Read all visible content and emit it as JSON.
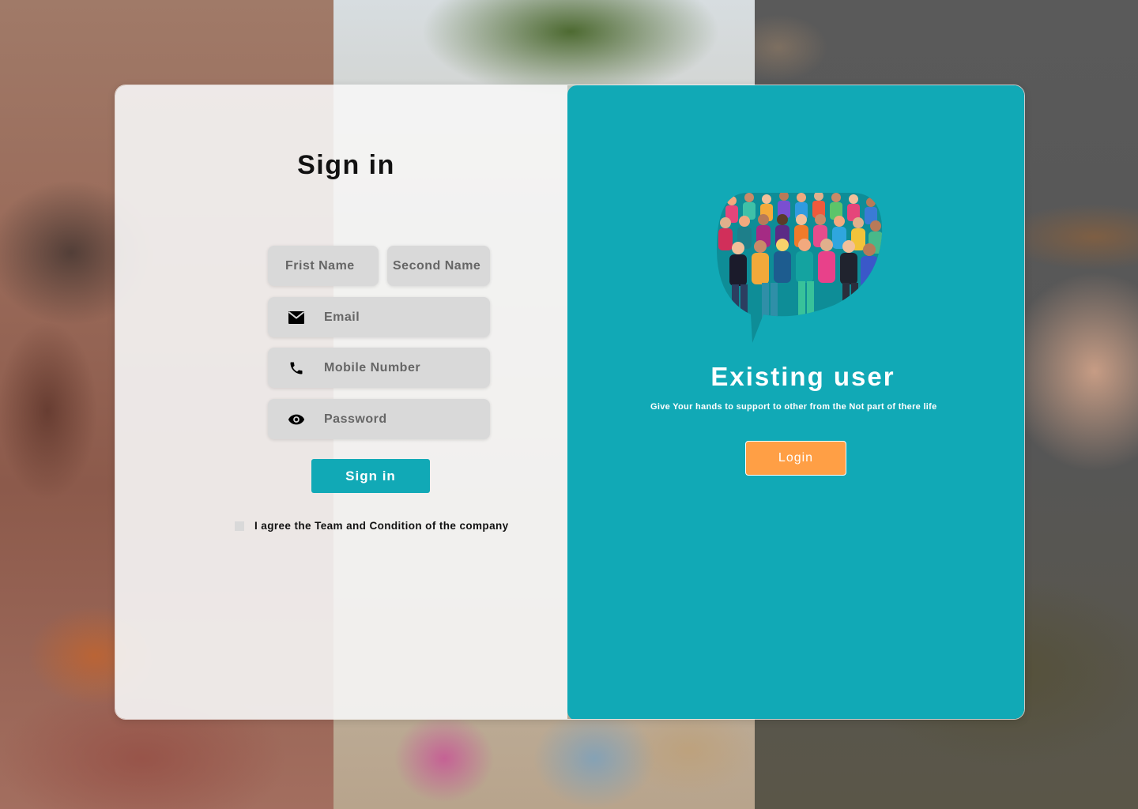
{
  "signin": {
    "title": "Sign in",
    "fields": {
      "first_name": {
        "placeholder": "Frist Name",
        "value": ""
      },
      "second_name": {
        "placeholder": "Second Name",
        "value": ""
      },
      "email": {
        "placeholder": "Email",
        "value": "",
        "icon": "envelope-icon"
      },
      "mobile": {
        "placeholder": "Mobile Number",
        "value": "",
        "icon": "phone-icon"
      },
      "password": {
        "placeholder": "Password",
        "value": "",
        "icon": "eye-icon"
      }
    },
    "submit_label": "Sign in",
    "terms_label": "I agree the Team and  Condition of the company",
    "terms_checked": false
  },
  "existing": {
    "illustration": "crowd-speech-bubble-illustration",
    "title": "Existing user",
    "tagline": "Give Your hands to support to other from the Not part of there life",
    "login_label": "Login"
  },
  "colors": {
    "accent_teal": "#11a9b6",
    "login_orange": "#ff9f45",
    "field_gray": "#d9d9d9",
    "panel_light": "#f6f6f6"
  }
}
